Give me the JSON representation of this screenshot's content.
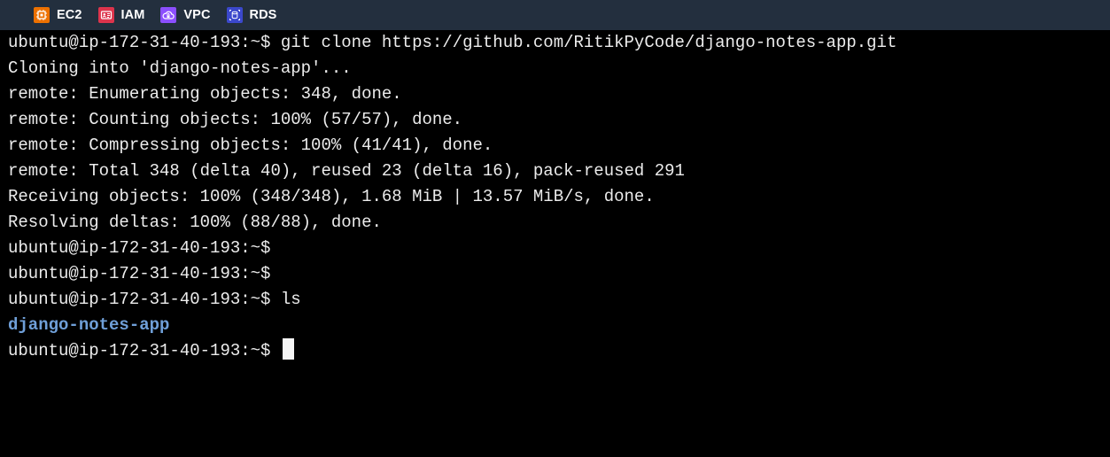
{
  "toolbar": {
    "services": [
      {
        "label": "EC2",
        "icon": "ec2-icon",
        "color": "#ed7100"
      },
      {
        "label": "IAM",
        "icon": "iam-icon",
        "color": "#dd344c"
      },
      {
        "label": "VPC",
        "icon": "vpc-icon",
        "color": "#8c4fff"
      },
      {
        "label": "RDS",
        "icon": "rds-icon",
        "color": "#3b48cc"
      }
    ]
  },
  "terminal": {
    "lines": [
      "ubuntu@ip-172-31-40-193:~$ git clone https://github.com/RitikPyCode/django-notes-app.git",
      "Cloning into 'django-notes-app'...",
      "remote: Enumerating objects: 348, done.",
      "remote: Counting objects: 100% (57/57), done.",
      "remote: Compressing objects: 100% (41/41), done.",
      "remote: Total 348 (delta 40), reused 23 (delta 16), pack-reused 291",
      "Receiving objects: 100% (348/348), 1.68 MiB | 13.57 MiB/s, done.",
      "Resolving deltas: 100% (88/88), done.",
      "ubuntu@ip-172-31-40-193:~$",
      "ubuntu@ip-172-31-40-193:~$",
      "ubuntu@ip-172-31-40-193:~$ ls"
    ],
    "ls_output": "django-notes-app",
    "prompt": "ubuntu@ip-172-31-40-193:~$ ",
    "colors": {
      "background": "#000000",
      "text": "#ececec",
      "directory": "#6f9fd8"
    }
  }
}
